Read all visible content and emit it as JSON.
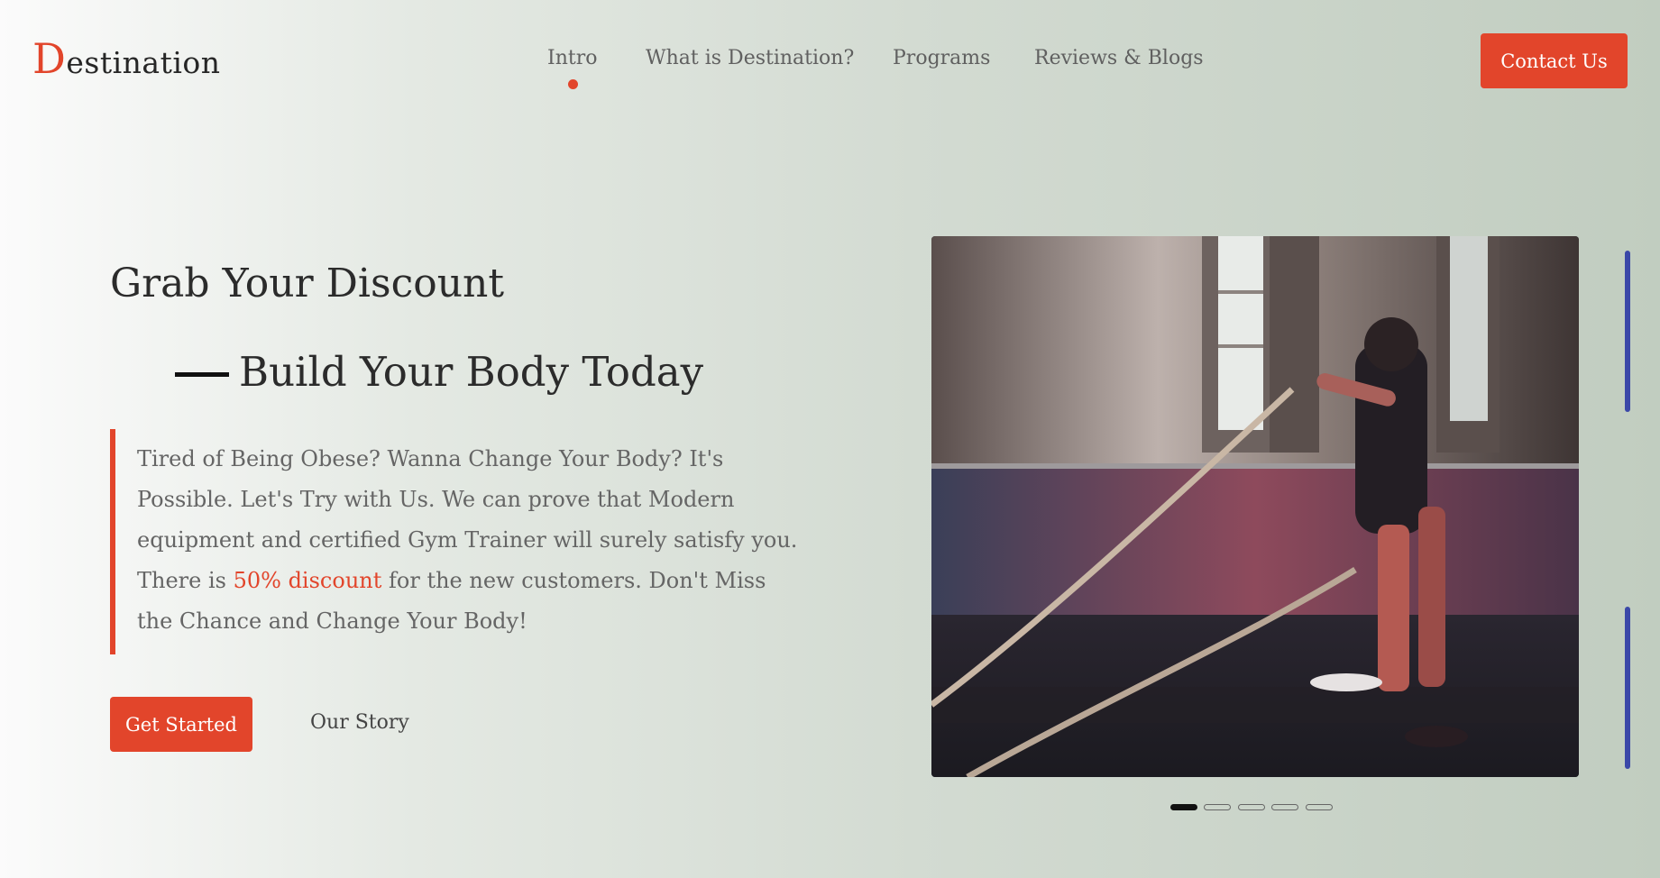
{
  "brand": {
    "logo_first": "D",
    "logo_rest": "estination"
  },
  "nav": {
    "items": [
      {
        "label": "Intro",
        "active": true
      },
      {
        "label": "What is Destination?",
        "active": false
      },
      {
        "label": "Programs",
        "active": false
      },
      {
        "label": "Reviews & Blogs",
        "active": false
      }
    ],
    "contact_label": "Contact Us"
  },
  "hero": {
    "title": "Grab Your Discount",
    "subtitle": "Build Your Body Today",
    "desc_part1": "Tired of Being Obese? Wanna Change Your Body? It's Possible. Let's Try with Us. We can prove that Modern equipment and certified Gym Trainer will surely satisfy you. There is ",
    "desc_highlight": "50% discount",
    "desc_part2": " for the new customers. Don't Miss the Chance and Change Your Body!",
    "primary_button": "Get Started",
    "secondary_link": "Our Story"
  },
  "carousel": {
    "slide_count": 5,
    "active_index": 0
  },
  "colors": {
    "accent": "#e2452b",
    "side_bar": "#3b48a8",
    "text_dark": "#2b2b2b",
    "text_muted": "#656565"
  }
}
